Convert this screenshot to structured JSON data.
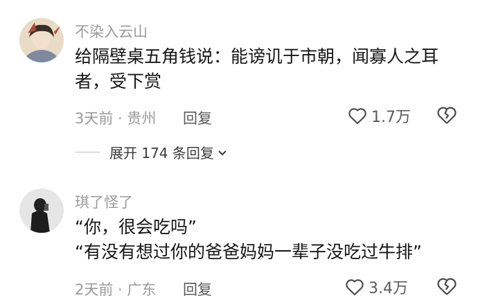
{
  "comments": [
    {
      "username": "不染入云山",
      "lines": [
        "给隔壁桌五角钱说：能谤讥于市朝，闻寡人之耳",
        "者，受下赏"
      ],
      "time_location": "3天前 · 贵州",
      "reply_label": "回复",
      "likes": "1.7万",
      "expand_label": "展开 174 条回复"
    },
    {
      "username": "琪了怪了",
      "lines": [
        "“你，很会吃吗”",
        "“有没有想过你的爸爸妈妈一辈子没吃过牛排”"
      ],
      "time_location": "2天前 · 广东",
      "reply_label": "回复",
      "likes": "3.4万"
    }
  ],
  "colors": {
    "muted": "#9a9a9a",
    "text": "#161616"
  }
}
